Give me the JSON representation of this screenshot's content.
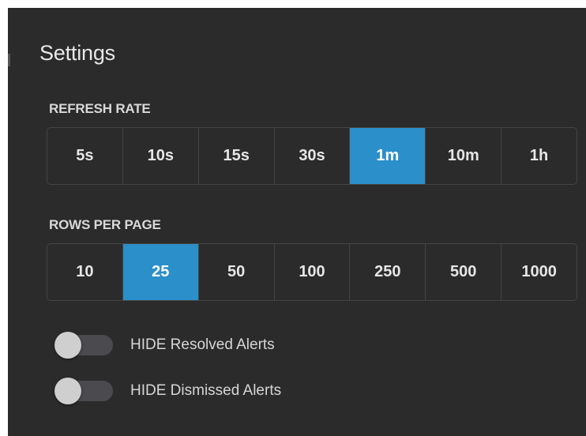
{
  "title": "Settings",
  "refresh_rate": {
    "label": "REFRESH RATE",
    "options": [
      "5s",
      "10s",
      "15s",
      "30s",
      "1m",
      "10m",
      "1h"
    ],
    "selected": "1m"
  },
  "rows_per_page": {
    "label": "ROWS PER PAGE",
    "options": [
      "10",
      "25",
      "50",
      "100",
      "250",
      "500",
      "1000"
    ],
    "selected": "25"
  },
  "toggles": [
    {
      "label": "HIDE Resolved Alerts",
      "on": false
    },
    {
      "label": "HIDE Dismissed Alerts",
      "on": false
    }
  ],
  "colors": {
    "panel_bg": "#2b2b2b",
    "accent": "#2b8fc9",
    "border": "#444444",
    "toggle_track": "#4a4a4f",
    "toggle_knob": "#cfcfcf"
  }
}
